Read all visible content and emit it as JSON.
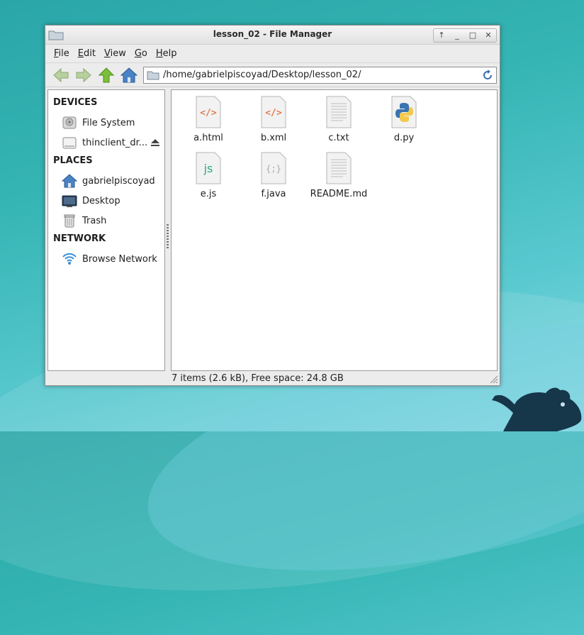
{
  "window": {
    "title": "lesson_02 - File Manager",
    "controls": [
      "↑",
      "_",
      "□",
      "✕"
    ]
  },
  "menu": [
    "File",
    "Edit",
    "View",
    "Go",
    "Help"
  ],
  "toolbar": {
    "path": "/home/gabrielpiscoyad/Desktop/lesson_02/"
  },
  "sidebar": {
    "devices": {
      "heading": "DEVICES",
      "items": [
        {
          "label": "File System",
          "icon": "harddisk-icon"
        },
        {
          "label": "thinclient_dr...",
          "icon": "drive-icon"
        }
      ]
    },
    "places": {
      "heading": "PLACES",
      "items": [
        {
          "label": "gabrielpiscoyad",
          "icon": "home-icon"
        },
        {
          "label": "Desktop",
          "icon": "desktop-icon"
        },
        {
          "label": "Trash",
          "icon": "trash-icon"
        }
      ]
    },
    "network": {
      "heading": "NETWORK",
      "items": [
        {
          "label": "Browse Network",
          "icon": "network-icon"
        }
      ]
    }
  },
  "files": [
    {
      "name": "a.html",
      "glyph": "</>",
      "color": "#e0622a"
    },
    {
      "name": "b.xml",
      "glyph": "</>",
      "color": "#e0622a"
    },
    {
      "name": "c.txt",
      "glyph": "",
      "color": "#9a9a9a"
    },
    {
      "name": "d.py",
      "glyph": "",
      "color": "#3a74b0"
    },
    {
      "name": "e.js",
      "glyph": "js",
      "color": "#2aa889"
    },
    {
      "name": "f.java",
      "glyph": "{;}",
      "color": "#aaaaaa"
    },
    {
      "name": "README.md",
      "glyph": "",
      "color": "#9a9a9a"
    }
  ],
  "status": "7 items (2.6 kB), Free space: 24.8 GB",
  "colors": {
    "accent": "#3a6fb0",
    "nav_green": "#6aa13a"
  }
}
